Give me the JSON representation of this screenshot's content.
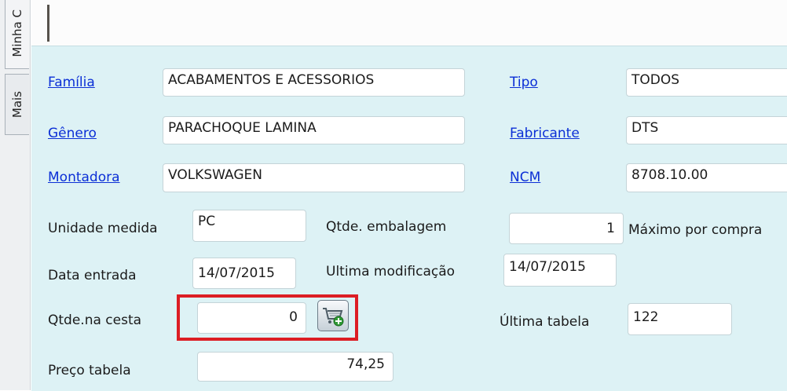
{
  "side_tabs": {
    "minha": "Minha C",
    "mais": "Mais"
  },
  "form": {
    "familia": {
      "label": "Família",
      "value": "ACABAMENTOS E ACESSORIOS"
    },
    "tipo": {
      "label": "Tipo",
      "value": "TODOS"
    },
    "genero": {
      "label": "Gênero",
      "value": "PARACHOQUE LAMINA"
    },
    "fabricante": {
      "label": "Fabricante",
      "value": "DTS"
    },
    "montadora": {
      "label": "Montadora",
      "value": "VOLKSWAGEN"
    },
    "ncm": {
      "label": "NCM",
      "value": "8708.10.00"
    },
    "unidade_medida": {
      "label": "Unidade medida",
      "value": "PC"
    },
    "qtde_embalagem": {
      "label": "Qtde. embalagem",
      "value": "1"
    },
    "maximo_compra": {
      "label": "Máximo por compra"
    },
    "data_entrada": {
      "label": "Data entrada",
      "value": "14/07/2015"
    },
    "ultima_modificacao": {
      "label": "Ultima modificação",
      "value": "14/07/2015"
    },
    "qtde_cesta": {
      "label": "Qtde.na cesta",
      "value": "0"
    },
    "ultima_tabela": {
      "label": "Última tabela",
      "value": "122"
    },
    "preco_tabela": {
      "label": "Preço tabela",
      "value": "74,25"
    }
  },
  "icons": {
    "cart_button": "add-to-cart-icon"
  },
  "colors": {
    "link": "#0b2fd6",
    "panel_bg": "#ddf2f5",
    "highlight": "#dc1e24"
  }
}
